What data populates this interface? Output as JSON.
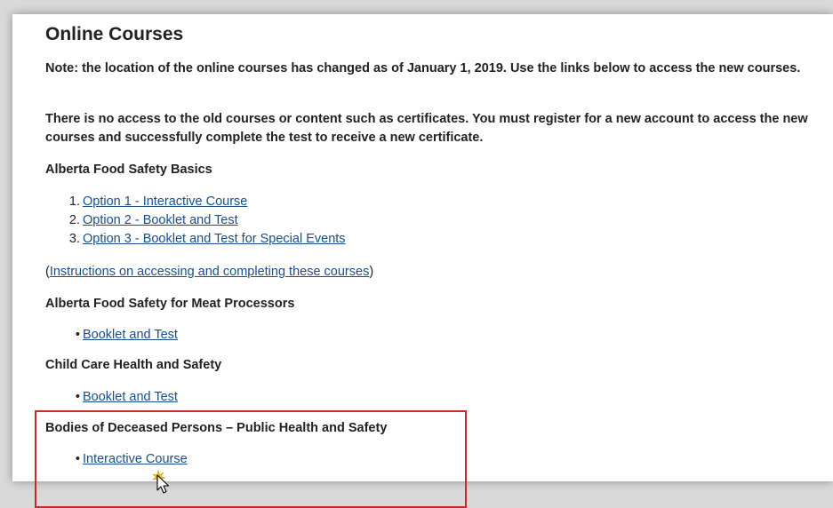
{
  "page": {
    "title": "Online Courses",
    "notes": [
      "Note: the location of the online courses has changed as of January 1, 2019. Use the links below to access the new courses.",
      "There is no access to the old courses or content such as certificates. You must register for a new account to access the new courses and successfully complete the test to receive a new certificate."
    ]
  },
  "sections": {
    "basics": {
      "heading": "Alberta Food Safety Basics",
      "options": [
        {
          "num": "1.",
          "label": "Option 1 - Interactive Course"
        },
        {
          "num": "2.",
          "label": "Option 2 - Booklet and Test"
        },
        {
          "num": "3.",
          "label": "Option 3 - Booklet and Test for Special Events"
        }
      ],
      "instructions": {
        "open": "(",
        "link": "Instructions on accessing and completing these courses",
        "close": ")"
      }
    },
    "meat": {
      "heading": "Alberta Food Safety for Meat Processors",
      "link": "Booklet and Test"
    },
    "childcare": {
      "heading": "Child Care Health and Safety",
      "link": "Booklet and Test"
    },
    "deceased": {
      "heading": "Bodies of Deceased Persons – Public Health and Safety",
      "link": "Interactive Course"
    }
  },
  "colors": {
    "link": "#1a4e8a",
    "highlight": "#c62a2a",
    "click_indicator": "#f5c518"
  },
  "icons": {
    "bullet": "•",
    "cursor": "mouse-pointer-icon"
  }
}
